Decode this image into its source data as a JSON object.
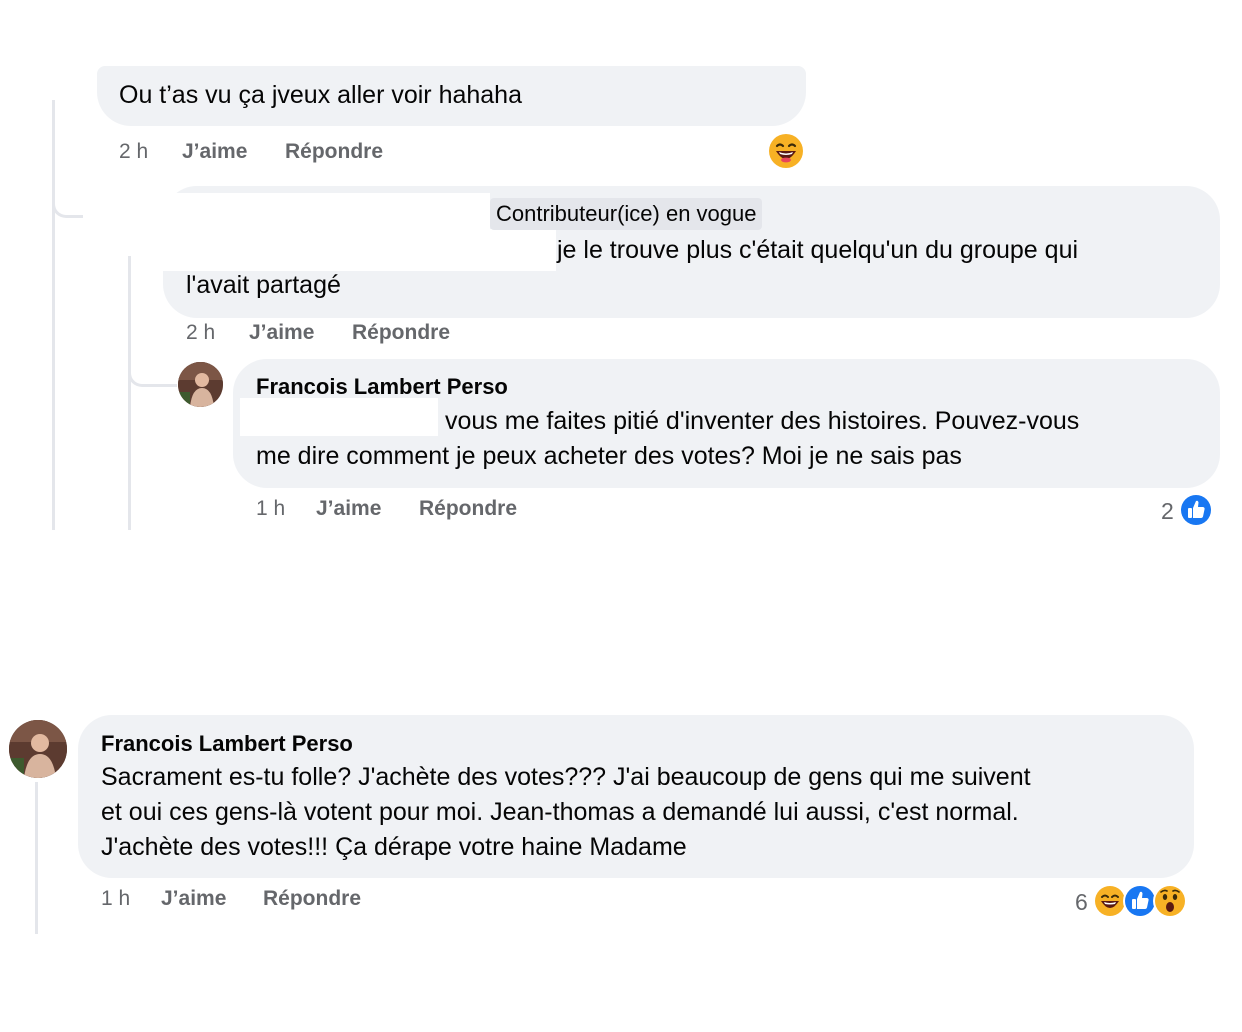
{
  "comment1": {
    "text": "Ou t’as vu ça jveux aller voir hahaha",
    "time": "2 h",
    "like": "J’aime",
    "reply": "Répondre"
  },
  "comment2": {
    "badge": "Contributeur(ice) en vogue",
    "text_line1": "je le trouve plus c'était quelqu'un du groupe qui",
    "text_line2": "l'avait partagé",
    "time": "2 h",
    "like": "J’aime",
    "reply": "Répondre"
  },
  "comment3": {
    "author": "Francois Lambert Perso",
    "text_line1": "vous me faites pitié d'inventer des histoires. Pouvez-vous",
    "text_line2": "me dire comment je peux acheter des votes? Moi je ne sais pas",
    "time": "1 h",
    "like": "J’aime",
    "reply": "Répondre",
    "reaction_count": "2"
  },
  "comment4": {
    "author": "Francois Lambert Perso",
    "text_line1": "Sacrament es-tu folle? J'achète des votes??? J'ai beaucoup de gens qui me suivent",
    "text_line2": "et oui ces gens-là votent pour moi. Jean-thomas a demandé lui aussi, c'est normal.",
    "text_line3": "J'achète des votes!!! Ça dérape votre haine Madame",
    "time": "1 h",
    "like": "J’aime",
    "reply": "Répondre",
    "reaction_count": "6"
  },
  "icons": {
    "laugh": "laugh-reaction-icon",
    "like": "like-reaction-icon",
    "wow": "wow-reaction-icon"
  },
  "colors": {
    "bubble": "#f0f2f5",
    "meta": "#65676b",
    "like_blue": "#1877f2",
    "emoji_yellow": "#f7b125"
  }
}
